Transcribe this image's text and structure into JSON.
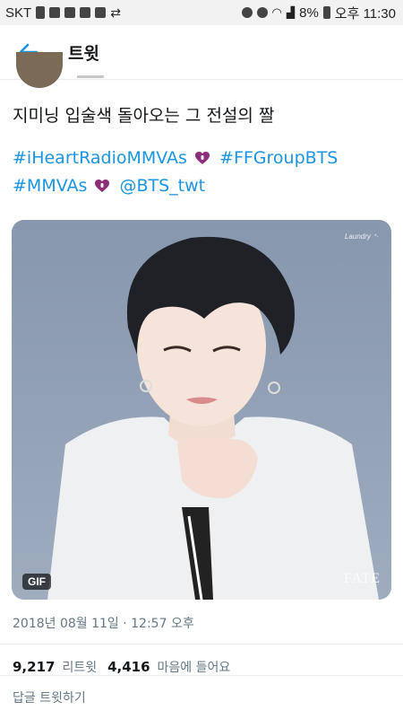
{
  "status_bar": {
    "carrier": "SKT",
    "battery": "8%",
    "time": "오후 11:30"
  },
  "app_bar": {
    "title": "트윗",
    "back_icon": "arrow-left-icon",
    "accent": "#1b95e0"
  },
  "tweet": {
    "text": "지미닝 입술색 돌아오는 그 전설의 짤",
    "hashtag1": "#iHeartRadioMMVAs",
    "hashtag2": "#FFGroupBTS",
    "hashtag3": "#MMVAs",
    "mention": "@BTS_twt",
    "media": {
      "badge": "GIF",
      "watermark_top": "Laundry ⁺·",
      "watermark_bottom": "FATE"
    },
    "timestamp": "2018년 08월 11일 · 12:57 오후",
    "retweet_count": "9,217",
    "retweet_label": "리트윗",
    "like_count": "4,416",
    "like_label": "마음에 들어요"
  },
  "reply": {
    "placeholder": "답글 트윗하기"
  }
}
